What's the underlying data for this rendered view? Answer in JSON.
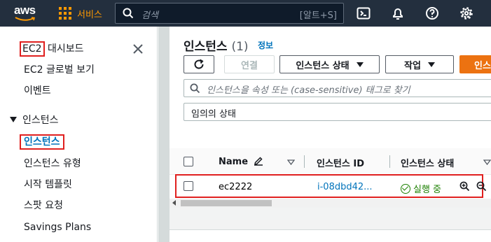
{
  "topnav": {
    "logo_text": "aws",
    "services_label": "서비스",
    "search_placeholder": "검색",
    "search_shortcut": "[알트+S]",
    "icons": [
      "cloudshell-icon",
      "bell-icon",
      "help-icon",
      "gear-icon"
    ]
  },
  "sidebar": {
    "dashboard_ec2": "EC2",
    "dashboard_rest": " 대시보드",
    "items_top": [
      "EC2 글로벌 보기",
      "이벤트"
    ],
    "section_title": "인스턴스",
    "section_items": [
      "인스턴스",
      "인스턴스 유형",
      "시작 템플릿",
      "스팟 요청",
      "Savings Plans"
    ]
  },
  "main": {
    "title": "인스턴스",
    "count": "(1)",
    "info": "정보",
    "buttons": {
      "connect": "연결",
      "instance_state": "인스턴스 상태",
      "actions": "작업",
      "launch_partial": "인스"
    },
    "filter_placeholder": "인스턴스을 속성 또는 (case-sensitive) 태그로 찾기",
    "select_value": "임의의 상태",
    "columns": [
      "Name",
      "인스턴스 ID",
      "인스턴스 상태"
    ],
    "rows": [
      {
        "name": "ec2222",
        "instance_id": "i-08dbd42...",
        "state": "실행 중"
      }
    ]
  },
  "colors": {
    "nav_bg": "#232f3e",
    "accent_orange": "#ff9900",
    "link_blue": "#0073bb",
    "running_green": "#1d8102",
    "highlight_red": "#e0201f"
  }
}
